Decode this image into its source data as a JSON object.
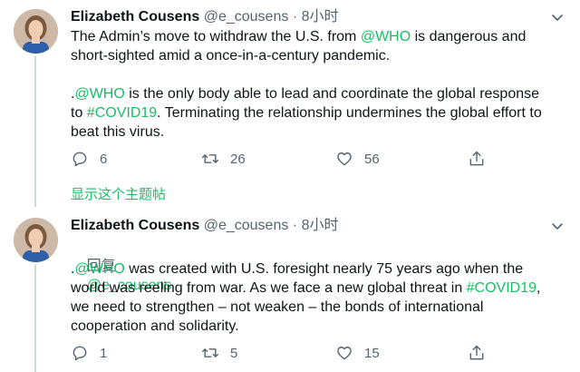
{
  "tweets": [
    {
      "name": "Elizabeth Cousens",
      "handle": "@e_cousens",
      "dot": "·",
      "time": "8小时",
      "text_lines": [
        [
          {
            "t": "The Admin’s move to withdraw the U.S. from ",
            "c": "n"
          },
          {
            "t": "@WHO",
            "c": "g"
          },
          {
            "t": " is dangerous and",
            "c": "n"
          }
        ],
        [
          {
            "t": "short-sighted amid a once-in-a-century pandemic.",
            "c": "n"
          }
        ],
        [
          {
            "t": "",
            "c": "n"
          }
        ],
        [
          {
            "t": ".",
            "c": "n"
          },
          {
            "t": "@WHO",
            "c": "g"
          },
          {
            "t": " is the only body able to lead and coordinate the global response",
            "c": "n"
          }
        ],
        [
          {
            "t": "to ",
            "c": "n"
          },
          {
            "t": "#COVID19",
            "c": "g"
          },
          {
            "t": ". Terminating the relationship undermines the global effort to",
            "c": "n"
          }
        ],
        [
          {
            "t": "beat this virus.",
            "c": "n"
          }
        ]
      ],
      "replies": "6",
      "retweets": "26",
      "likes": "56"
    },
    {
      "name": "Elizabeth Cousens",
      "handle": "@e_cousens",
      "dot": "·",
      "time": "8小时",
      "reply_prefix": "回复",
      "reply_to": "@e_cousens",
      "text_lines": [
        [
          {
            "t": ".",
            "c": "n"
          },
          {
            "t": "@WHO",
            "c": "g"
          },
          {
            "t": " was created with U.S. foresight nearly 75 years ago when the",
            "c": "n"
          }
        ],
        [
          {
            "t": "world was reeling from war. As we face a new global threat in ",
            "c": "n"
          },
          {
            "t": "#COVID19",
            "c": "g"
          },
          {
            "t": ",",
            "c": "n"
          }
        ],
        [
          {
            "t": "we need to strengthen – not weaken – the bonds of international",
            "c": "n"
          }
        ],
        [
          {
            "t": "cooperation and solidarity.",
            "c": "n"
          }
        ]
      ],
      "replies": "1",
      "retweets": "5",
      "likes": "15"
    }
  ],
  "show_thread": "显示这个主题帖",
  "colors": {
    "accent_green": "#17bf63",
    "secondary_text": "#536471",
    "thread_line": "#cfd9de"
  },
  "icons": {
    "reply": "reply-icon",
    "retweet": "retweet-icon",
    "like": "heart-icon",
    "share": "share-icon",
    "caret": "chevron-down-icon"
  }
}
